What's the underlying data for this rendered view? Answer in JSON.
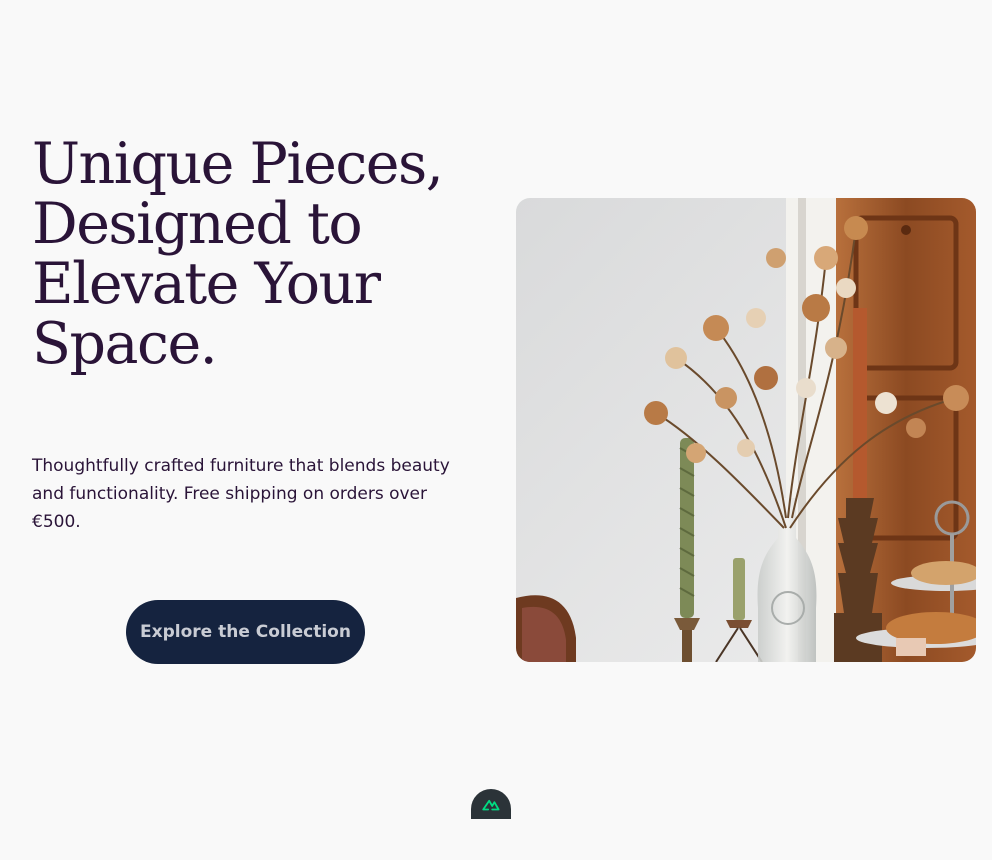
{
  "hero": {
    "title": "Unique Pieces, Designed to Elevate Your Space.",
    "subtitle": "Thoughtfully crafted furniture that blends beauty and functionality. Free shipping on orders over €500.",
    "cta_label": "Explore the Collection"
  },
  "image": {
    "subject": "dried flowers in glass vases with candles and a wooden door"
  },
  "devtools": {
    "icon": "nuxt-logo-icon",
    "accent": "#00dc82"
  },
  "colors": {
    "heading": "#2a1438",
    "button_bg": "#15233f",
    "background": "#f9f9f9"
  }
}
